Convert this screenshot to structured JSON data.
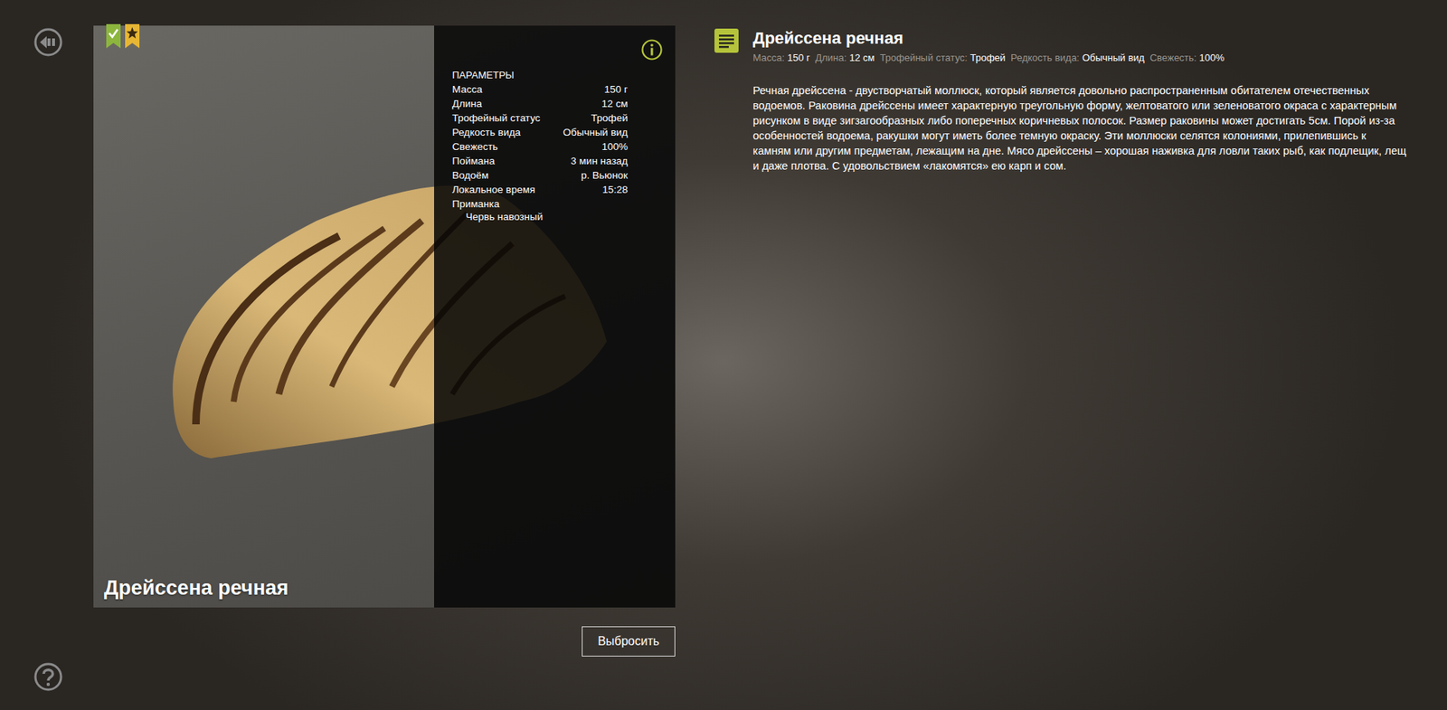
{
  "card": {
    "title": "Дрейссена речная",
    "params_title": "ПАРАМЕТРЫ",
    "params": [
      {
        "label": "Масса",
        "value": "150 г"
      },
      {
        "label": "Длина",
        "value": "12 см"
      },
      {
        "label": "Трофейный статус",
        "value": "Трофей"
      },
      {
        "label": "Редкость вида",
        "value": "Обычный вид"
      },
      {
        "label": "Свежесть",
        "value": "100%"
      },
      {
        "label": "Поймана",
        "value": "3 мин назад"
      },
      {
        "label": "Водоём",
        "value": "р. Вьюнок"
      },
      {
        "label": "Локальное время",
        "value": "15:28"
      }
    ],
    "bait": {
      "label": "Приманка",
      "items": [
        "Червь навозный"
      ]
    }
  },
  "discard_button": "Выбросить",
  "info": {
    "title": "Дрейссена речная",
    "stats": [
      {
        "label": "Масса:",
        "value": "150 г"
      },
      {
        "label": "Длина:",
        "value": "12 см"
      },
      {
        "label": "Трофейный статус:",
        "value": "Трофей"
      },
      {
        "label": "Редкость вида:",
        "value": "Обычный вид"
      },
      {
        "label": "Свежесть:",
        "value": "100%"
      }
    ],
    "description": "Речная дрейссена - двустворчатый моллюск, который является довольно распространенным обитателем отечественных водоемов. Раковина дрейссены имеет характерную треугольную форму, желтоватого или зеленоватого окраса с характерным рисунком в виде зигзагообразных либо поперечных коричневых полосок. Размер раковины может достигать 5см. Порой из-за особенностей водоема, ракушки могут иметь более темную окраску. Эти моллюски селятся колониями, прилепившись к камням или другим предметам, лежащим на дне. Мясо дрейссены – хорошая наживка для ловли таких рыб, как подлещик, лещ и даже плотва. С удовольствием «лакомятся» ею карп и сом."
  }
}
